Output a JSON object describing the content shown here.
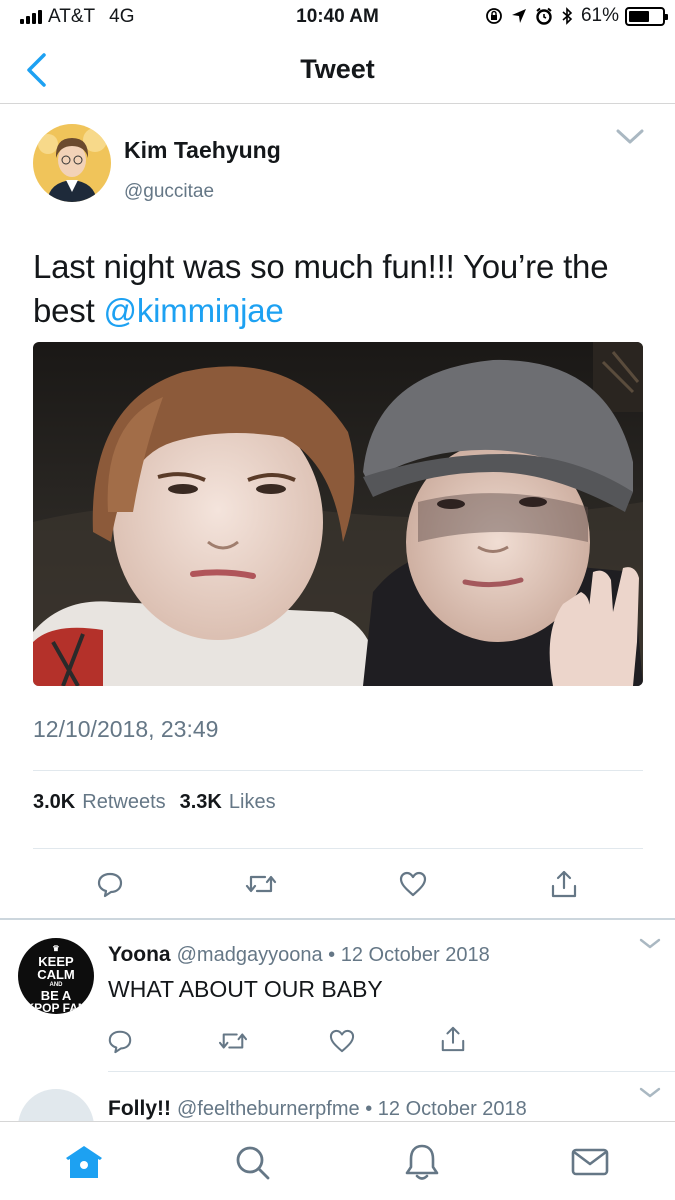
{
  "status_bar": {
    "carrier": "AT&T",
    "network": "4G",
    "time": "10:40 AM",
    "battery": "61%",
    "battery_level": 0.61
  },
  "nav": {
    "title": "Tweet",
    "back_icon": "chevron-left-icon"
  },
  "tweet": {
    "author_name": "Kim Taehyung",
    "author_handle": "@guccitae",
    "text_before": "Last night was so much fun!!! You’re the best ",
    "mention": "@kimminjae",
    "timestamp": "12/10/2018, 23:49",
    "retweets_count": "3.0K",
    "retweets_label": "Retweets",
    "likes_count": "3.3K",
    "likes_label": "Likes",
    "actions": [
      "reply-icon",
      "retweet-icon",
      "like-icon",
      "share-icon"
    ]
  },
  "replies": [
    {
      "name": "Yoona",
      "handle": "@madgayyoona",
      "date": "12 October 2018",
      "text": "WHAT ABOUT OUR BABY",
      "avatar_lines": [
        "KEEP",
        "CALM",
        "AND",
        "BE A",
        "KPOP FAN"
      ]
    },
    {
      "name": "Folly!!",
      "handle": "@feeltheburnerpfme",
      "date": "12 October 2018",
      "text": ""
    }
  ],
  "separator": "•",
  "tab_bar": {
    "tabs": [
      "home-icon",
      "search-icon",
      "notifications-icon",
      "messages-icon"
    ],
    "active": "home-icon"
  },
  "colors": {
    "link": "#1da1f2",
    "secondary_text": "#657786",
    "tab_active": "#1da1f2",
    "icon": "#657786"
  }
}
